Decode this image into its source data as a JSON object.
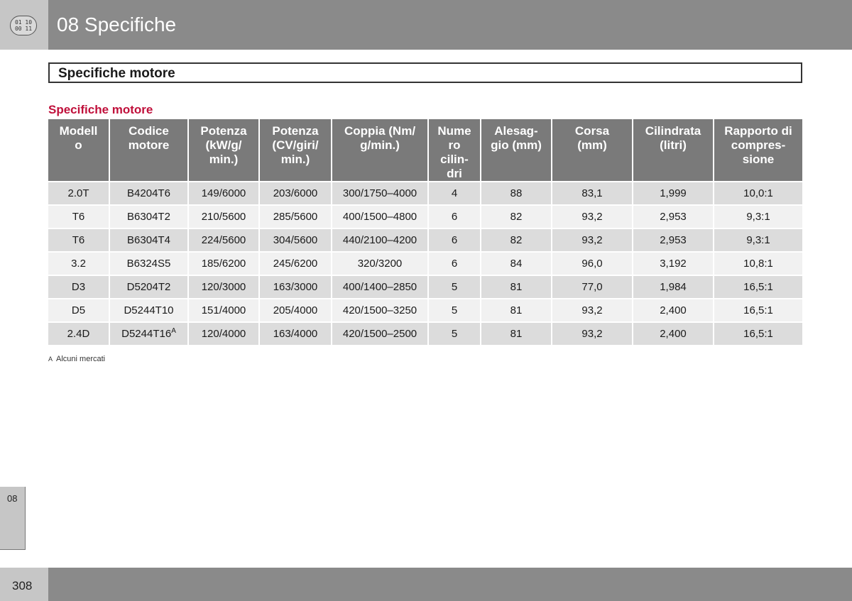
{
  "header": {
    "chapter_title": "08 Specifiche",
    "icon": {
      "name": "chapter-index-icon",
      "digits": [
        "01 10",
        "00 11"
      ]
    }
  },
  "section": {
    "title": "Specifiche motore"
  },
  "table": {
    "heading": "Specifiche motore",
    "columns": [
      [
        "Modell",
        "o"
      ],
      [
        "Codice",
        "motore"
      ],
      [
        "Potenza",
        "(kW/g/",
        "min.)"
      ],
      [
        "Potenza",
        "(CV/giri/",
        "min.)"
      ],
      [
        "Coppia (Nm/",
        "g/min.)"
      ],
      [
        "Nume",
        "ro",
        "cilin-",
        "dri"
      ],
      [
        "Alesag-",
        "gio (mm)"
      ],
      [
        "Corsa",
        "(mm)"
      ],
      [
        "Cilindrata",
        "(litri)"
      ],
      [
        "Rapporto di",
        "compres-",
        "sione"
      ]
    ],
    "rows": [
      {
        "cells": [
          "2.0T",
          "B4204T6",
          "149/6000",
          "203/6000",
          "300/1750–4000",
          "4",
          "88",
          "83,1",
          "1,999",
          "10,0:1"
        ],
        "sup": ""
      },
      {
        "cells": [
          "T6",
          "B6304T2",
          "210/5600",
          "285/5600",
          "400/1500–4800",
          "6",
          "82",
          "93,2",
          "2,953",
          "9,3:1"
        ],
        "sup": ""
      },
      {
        "cells": [
          "T6",
          "B6304T4",
          "224/5600",
          "304/5600",
          "440/2100–4200",
          "6",
          "82",
          "93,2",
          "2,953",
          "9,3:1"
        ],
        "sup": ""
      },
      {
        "cells": [
          "3.2",
          "B6324S5",
          "185/6200",
          "245/6200",
          "320/3200",
          "6",
          "84",
          "96,0",
          "3,192",
          "10,8:1"
        ],
        "sup": ""
      },
      {
        "cells": [
          "D3",
          "D5204T2",
          "120/3000",
          "163/3000",
          "400/1400–2850",
          "5",
          "81",
          "77,0",
          "1,984",
          "16,5:1"
        ],
        "sup": ""
      },
      {
        "cells": [
          "D5",
          "D5244T10",
          "151/4000",
          "205/4000",
          "420/1500–3250",
          "5",
          "81",
          "93,2",
          "2,400",
          "16,5:1"
        ],
        "sup": ""
      },
      {
        "cells": [
          "2.4D",
          "D5244T16",
          "120/4000",
          "163/4000",
          "420/1500–2500",
          "5",
          "81",
          "93,2",
          "2,400",
          "16,5:1"
        ],
        "sup": "A"
      }
    ],
    "footnote": {
      "mark": "A",
      "text": "Alcuni mercati"
    }
  },
  "side_tab": {
    "label": "08"
  },
  "footer": {
    "page_number": "308"
  },
  "colors": {
    "header_bar": "#8a8a8a",
    "header_box": "#c6c6c6",
    "table_header": "#7a7a7a",
    "row_shade": "#dcdcdc",
    "row_light": "#f1f1f1",
    "heading_accent": "#c0103b"
  }
}
